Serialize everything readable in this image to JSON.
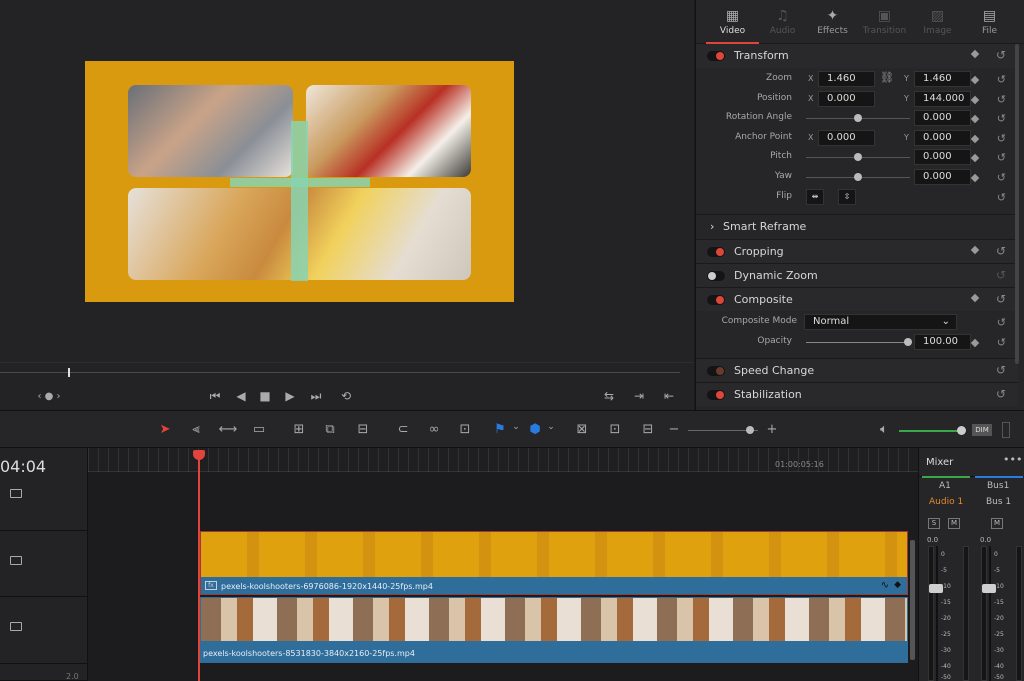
{
  "inspector": {
    "tabs": [
      {
        "label": "Video",
        "icon": "film-icon"
      },
      {
        "label": "Audio",
        "icon": "music-note-icon"
      },
      {
        "label": "Effects",
        "icon": "magic-wand-icon"
      },
      {
        "label": "Transition",
        "icon": "transition-icon"
      },
      {
        "label": "Image",
        "icon": "image-icon"
      },
      {
        "label": "File",
        "icon": "folder-icon"
      }
    ],
    "transform": {
      "title": "Transform",
      "zoom": {
        "label": "Zoom",
        "x_axis": "X",
        "y_axis": "Y",
        "x": "1.460",
        "y": "1.460"
      },
      "position": {
        "label": "Position",
        "x_axis": "X",
        "y_axis": "Y",
        "x": "0.000",
        "y": "144.000"
      },
      "rotation": {
        "label": "Rotation Angle",
        "value": "0.000"
      },
      "anchor": {
        "label": "Anchor Point",
        "x_axis": "X",
        "y_axis": "Y",
        "x": "0.000",
        "y": "0.000"
      },
      "pitch": {
        "label": "Pitch",
        "value": "0.000"
      },
      "yaw": {
        "label": "Yaw",
        "value": "0.000"
      },
      "flip": {
        "label": "Flip"
      }
    },
    "smart_reframe": "Smart Reframe",
    "cropping": "Cropping",
    "dynamic_zoom": "Dynamic Zoom",
    "composite": {
      "title": "Composite",
      "mode_label": "Composite Mode",
      "mode_value": "Normal",
      "opacity_label": "Opacity",
      "opacity_value": "100.00"
    },
    "speed_change": "Speed Change",
    "stabilization": "Stabilization"
  },
  "timeline": {
    "timecode": "04:04",
    "ruler_label": "01:00:05:16",
    "clip_top": "pexels-koolshooters-6976086-1920x1440-25fps.mp4",
    "clip_bottom": "pexels-koolshooters-8531830-3840x2160-25fps.mp4",
    "bottom_number": "2.0"
  },
  "mixer": {
    "title": "Mixer",
    "channels": [
      {
        "name": "A1",
        "track": "Audio 1",
        "level": "0.0"
      },
      {
        "name": "Bus1",
        "track": "Bus 1",
        "level": "0.0"
      }
    ],
    "solo": "S",
    "mute": "M",
    "scale": [
      "0",
      "-5",
      "-10",
      "-15",
      "-20",
      "-25",
      "-30",
      "-40",
      "-50"
    ]
  },
  "toolbar": {
    "dim_label": "DIM"
  },
  "colors": {
    "accent": "#e0443a",
    "clip_blue": "#2f6d9b",
    "frame_yellow": "#d99a10",
    "cross_mint": "#87d3b2"
  }
}
